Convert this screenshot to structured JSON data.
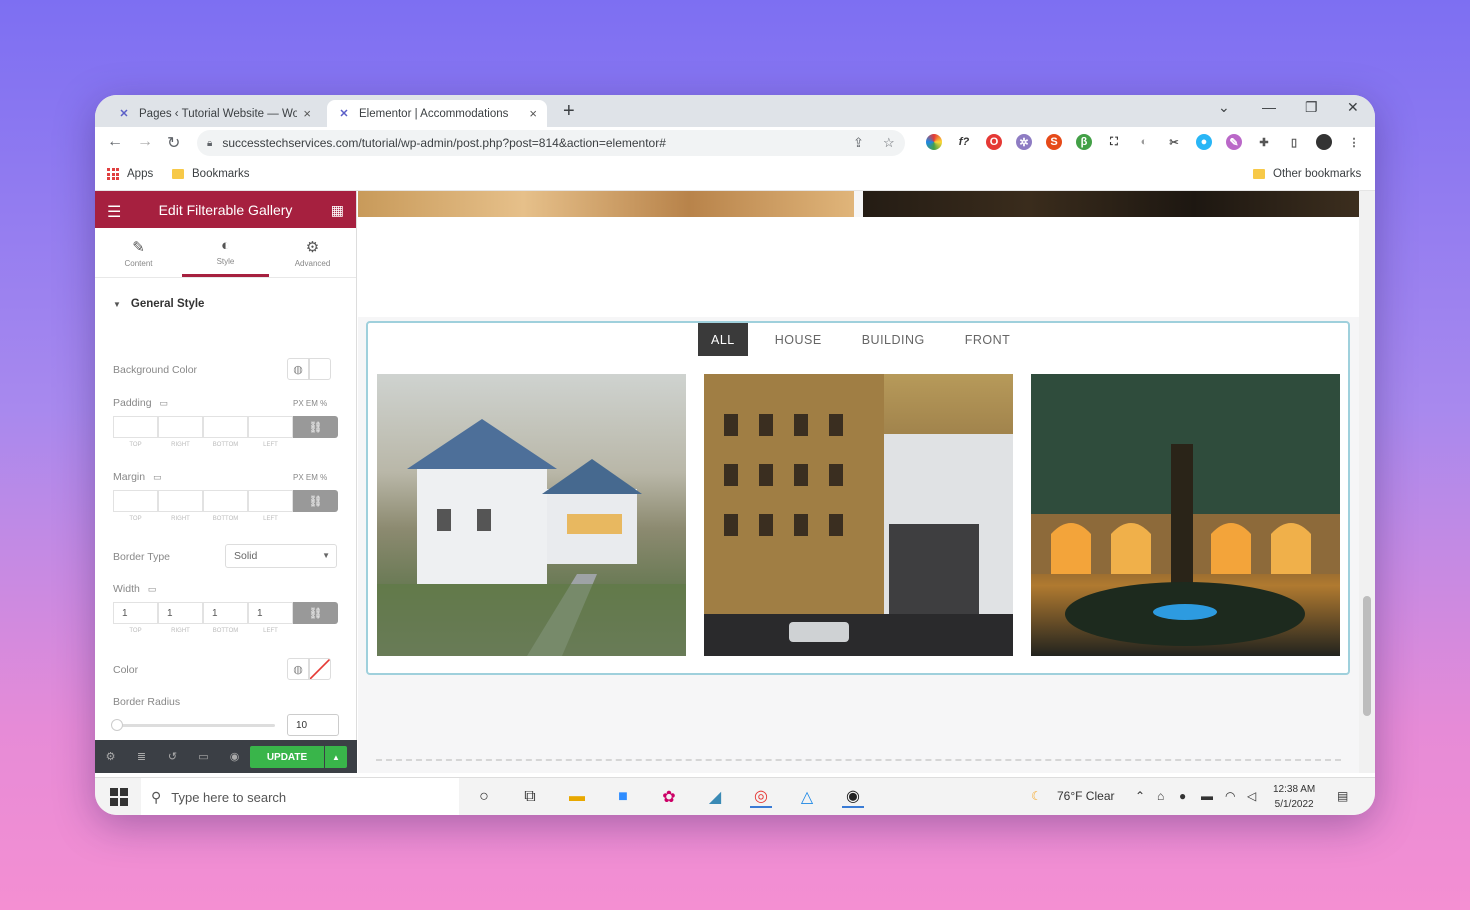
{
  "browser": {
    "tabs": [
      {
        "title": "Pages ‹ Tutorial Website — Word",
        "active": false
      },
      {
        "title": "Elementor | Accommodations",
        "active": true
      }
    ],
    "url": "successtechservices.com/tutorial/wp-admin/post.php?post=814&action=elementor#",
    "bookmarks": {
      "apps": "Apps",
      "bookmarks": "Bookmarks",
      "other": "Other bookmarks"
    }
  },
  "panel": {
    "title": "Edit Filterable Gallery",
    "tabs": [
      "Content",
      "Style",
      "Advanced"
    ],
    "active_tab": "Style",
    "section_title": "General Style",
    "background_color_label": "Background Color",
    "padding_label": "Padding",
    "margin_label": "Margin",
    "units": "PX  EM  %",
    "dim_sub": [
      "TOP",
      "RIGHT",
      "BOTTOM",
      "LEFT"
    ],
    "border_type_label": "Border Type",
    "border_type_value": "Solid",
    "width_label": "Width",
    "width_values": [
      "1",
      "1",
      "1",
      "1"
    ],
    "color_label": "Color",
    "border_radius_label": "Border Radius",
    "border_radius_value": "10",
    "update_label": "UPDATE"
  },
  "gallery": {
    "filters": [
      "ALL",
      "HOUSE",
      "BUILDING",
      "FRONT"
    ],
    "active_filter": "ALL"
  },
  "taskbar": {
    "search_placeholder": "Type here to search",
    "weather": "76°F  Clear",
    "time": "12:38 AM",
    "date": "5/1/2022"
  },
  "colors": {
    "elementor_brand": "#a6203f",
    "update_green": "#39b54a",
    "filter_active": "#3a3a3a"
  }
}
